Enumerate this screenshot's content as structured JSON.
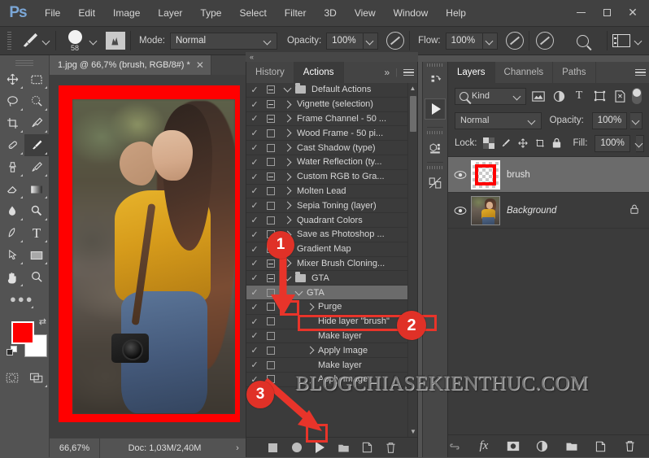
{
  "app": {
    "logo": "Ps",
    "menus": [
      "File",
      "Edit",
      "Image",
      "Layer",
      "Type",
      "Select",
      "Filter",
      "3D",
      "View",
      "Window",
      "Help"
    ],
    "window_buttons": [
      "minimize",
      "maximize",
      "close"
    ]
  },
  "options_bar": {
    "tool_icon": "brush-tool-icon",
    "brush_size": "58",
    "preset_icon": "brush-preset-icon",
    "mode_label": "Mode:",
    "mode_value": "Normal",
    "opacity_label": "Opacity:",
    "opacity_value": "100%",
    "flow_label": "Flow:",
    "flow_value": "100%",
    "airbrush_icon": "airbrush-icon",
    "smoothing_icon": "smoothing-icon",
    "symmetry_icon": "symmetry-icon",
    "search_icon": "search-icon",
    "workspace_icon": "workspace-switcher-icon"
  },
  "toolbar": {
    "tools": [
      {
        "name": "move-tool",
        "glyph": "✥"
      },
      {
        "name": "rectangular-marquee-tool",
        "glyph": "⬚"
      },
      {
        "name": "lasso-tool",
        "glyph": "⬭"
      },
      {
        "name": "quick-selection-tool",
        "glyph": "◌"
      },
      {
        "name": "crop-tool",
        "glyph": "⌙"
      },
      {
        "name": "eyedropper-tool",
        "glyph": "✐"
      },
      {
        "name": "spot-healing-brush-tool",
        "glyph": "✇"
      },
      {
        "name": "brush-tool",
        "glyph": "✐",
        "active": true
      },
      {
        "name": "clone-stamp-tool",
        "glyph": "⚑"
      },
      {
        "name": "history-brush-tool",
        "glyph": "✒"
      },
      {
        "name": "eraser-tool",
        "glyph": "▱"
      },
      {
        "name": "gradient-tool",
        "glyph": "■"
      },
      {
        "name": "blur-tool",
        "glyph": "●"
      },
      {
        "name": "dodge-tool",
        "glyph": "⚲"
      },
      {
        "name": "pen-tool",
        "glyph": "✑"
      },
      {
        "name": "horizontal-type-tool",
        "glyph": "T"
      },
      {
        "name": "path-selection-tool",
        "glyph": "➤"
      },
      {
        "name": "rectangle-tool",
        "glyph": "▭"
      },
      {
        "name": "hand-tool",
        "glyph": "✋"
      },
      {
        "name": "zoom-tool",
        "glyph": "⚲"
      }
    ],
    "more_tools": "edit-toolbar-icon",
    "foreground_color": "#ff0000",
    "background_color": "#ffffff",
    "quick_mask_icon": "quick-mask-icon",
    "screen_mode_icon": "screen-mode-icon"
  },
  "document": {
    "tab_title": "1.jpg @ 66,7% (brush, RGB/8#) *",
    "close_icon": "close-icon",
    "status_zoom": "66,67%",
    "status_doc": "Doc: 1,03M/2,40M",
    "canvas_border_color": "#ff0000"
  },
  "actions_panel": {
    "tabs": [
      {
        "label": "History",
        "active": false
      },
      {
        "label": "Actions",
        "active": true
      }
    ],
    "overflow_icon": "chevron-double-right-icon",
    "menu_icon": "panel-menu-icon",
    "rows": [
      {
        "check": true,
        "box": "dash",
        "twirl": "down",
        "icon": "folder",
        "label": "Default Actions",
        "indent": 0
      },
      {
        "check": true,
        "box": "dash",
        "twirl": "right",
        "icon": "",
        "label": "Vignette (selection)",
        "indent": 0
      },
      {
        "check": true,
        "box": "dash",
        "twirl": "right",
        "icon": "",
        "label": "Frame Channel - 50 ...",
        "indent": 0
      },
      {
        "check": true,
        "box": "empty",
        "twirl": "right",
        "icon": "",
        "label": "Wood Frame - 50 pi...",
        "indent": 0
      },
      {
        "check": true,
        "box": "empty",
        "twirl": "right",
        "icon": "",
        "label": "Cast Shadow (type)",
        "indent": 0
      },
      {
        "check": true,
        "box": "empty",
        "twirl": "right",
        "icon": "",
        "label": "Water Reflection (ty...",
        "indent": 0
      },
      {
        "check": true,
        "box": "dash",
        "twirl": "right",
        "icon": "",
        "label": "Custom RGB to Gra...",
        "indent": 0
      },
      {
        "check": true,
        "box": "empty",
        "twirl": "right",
        "icon": "",
        "label": "Molten Lead",
        "indent": 0
      },
      {
        "check": true,
        "box": "empty",
        "twirl": "right",
        "icon": "",
        "label": "Sepia Toning (layer)",
        "indent": 0
      },
      {
        "check": true,
        "box": "empty",
        "twirl": "right",
        "icon": "",
        "label": "Quadrant Colors",
        "indent": 0
      },
      {
        "check": true,
        "box": "empty",
        "twirl": "right",
        "icon": "",
        "label": "Save as Photoshop ...",
        "indent": 0
      },
      {
        "check": true,
        "box": "empty",
        "twirl": "right",
        "icon": "",
        "label": "Gradient Map",
        "indent": 0
      },
      {
        "check": true,
        "box": "dash",
        "twirl": "right",
        "icon": "",
        "label": "Mixer Brush Cloning...",
        "indent": 0
      },
      {
        "check": true,
        "box": "dash",
        "twirl": "down",
        "icon": "folder",
        "label": "GTA",
        "indent": 0
      },
      {
        "check": true,
        "box": "empty",
        "twirl": "down",
        "icon": "",
        "label": "GTA",
        "indent": 1,
        "selected": true
      },
      {
        "check": true,
        "box": "empty",
        "twirl": "right",
        "icon": "",
        "label": "Purge",
        "indent": 2
      },
      {
        "check": true,
        "box": "empty",
        "twirl": "",
        "icon": "",
        "label": "Hide layer \"brush\"",
        "indent": 2
      },
      {
        "check": true,
        "box": "empty",
        "twirl": "",
        "icon": "",
        "label": "Make layer",
        "indent": 2
      },
      {
        "check": true,
        "box": "empty",
        "twirl": "right",
        "icon": "",
        "label": "Apply Image",
        "indent": 2
      },
      {
        "check": true,
        "box": "empty",
        "twirl": "",
        "icon": "",
        "label": "Make layer",
        "indent": 2
      },
      {
        "check": true,
        "box": "empty",
        "twirl": "right",
        "icon": "",
        "label": "Apply Image",
        "indent": 2
      }
    ],
    "footer_buttons": [
      {
        "name": "stop-recording-button",
        "glyph": "stop"
      },
      {
        "name": "begin-recording-button",
        "glyph": "record"
      },
      {
        "name": "play-selection-button",
        "glyph": "play",
        "highlighted": true
      },
      {
        "name": "create-new-set-button",
        "glyph": "folder"
      },
      {
        "name": "create-new-action-button",
        "glyph": "newdoc"
      },
      {
        "name": "delete-button",
        "glyph": "trash"
      }
    ]
  },
  "vertical_strip": {
    "items": [
      {
        "name": "history-strip-icon"
      },
      {
        "name": "actions-play-strip-icon"
      },
      {
        "name": "3d-strip-icon"
      },
      {
        "name": "properties-strip-icon"
      }
    ]
  },
  "layers_panel": {
    "tabs": [
      {
        "label": "Layers",
        "active": true
      },
      {
        "label": "Channels",
        "active": false
      },
      {
        "label": "Paths",
        "active": false
      }
    ],
    "menu_icon": "panel-menu-icon",
    "filter": {
      "kind_label": "Kind",
      "search_icon": "search-icon",
      "icons": [
        "pixel-filter-icon",
        "adjustment-filter-icon",
        "type-filter-icon",
        "shape-filter-icon",
        "smart-object-filter-icon"
      ],
      "toggle": "filter-toggle"
    },
    "blend_mode": "Normal",
    "opacity_label": "Opacity:",
    "opacity_value": "100%",
    "lock_label": "Lock:",
    "lock_icons": [
      "lock-transparent-pixels-icon",
      "lock-image-pixels-icon",
      "lock-position-icon",
      "lock-artboard-icon",
      "lock-all-icon"
    ],
    "fill_label": "Fill:",
    "fill_value": "100%",
    "layers": [
      {
        "name": "brush",
        "visible": true,
        "selected": true,
        "thumb": "transparent-with-red-frame",
        "locked": false,
        "italic": false
      },
      {
        "name": "Background",
        "visible": true,
        "selected": false,
        "thumb": "photo",
        "locked": true,
        "italic": true
      }
    ],
    "footer_buttons": [
      {
        "name": "link-layers-button",
        "glyph": "link"
      },
      {
        "name": "layer-style-button",
        "glyph": "fx"
      },
      {
        "name": "add-layer-mask-button",
        "glyph": "mask"
      },
      {
        "name": "new-adjustment-layer-button",
        "glyph": "halfcircle"
      },
      {
        "name": "new-group-button",
        "glyph": "folder"
      },
      {
        "name": "new-layer-button",
        "glyph": "newdoc"
      },
      {
        "name": "delete-layer-button",
        "glyph": "trash"
      }
    ]
  },
  "annotations": {
    "badge_color": "#e03127",
    "arrow_color": "#e8342a",
    "steps": [
      {
        "number": "1",
        "target": "expand-gta-set-twirl"
      },
      {
        "number": "2",
        "target": "gta-action-row"
      },
      {
        "number": "3",
        "target": "play-selection-button"
      }
    ]
  },
  "watermark": {
    "text": "BLOGCHIASEKIENTHUC.COM"
  }
}
